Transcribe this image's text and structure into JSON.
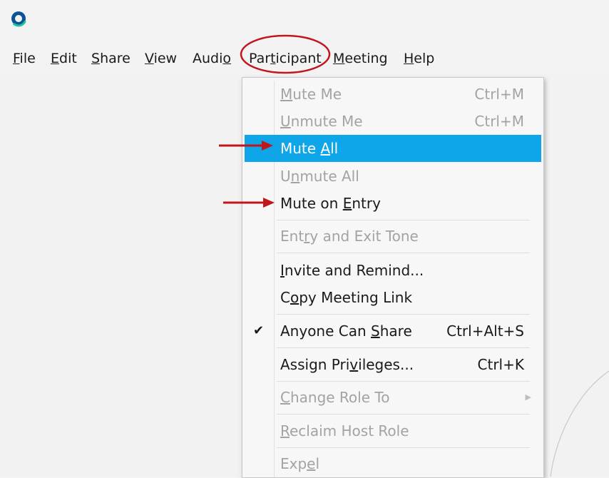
{
  "colors": {
    "selected_bg": "#0ea5e9",
    "disabled_text": "#a3a3a3",
    "annotation_red": "#c0161c"
  },
  "app": {
    "logo_icon": "webex-logo-icon"
  },
  "menubar": {
    "items": [
      {
        "pre": "",
        "u": "F",
        "post": "ile"
      },
      {
        "pre": "",
        "u": "E",
        "post": "dit"
      },
      {
        "pre": "",
        "u": "S",
        "post": "hare"
      },
      {
        "pre": "",
        "u": "V",
        "post": "iew"
      },
      {
        "pre": "Audi",
        "u": "o",
        "post": ""
      },
      {
        "pre": "Par",
        "u": "t",
        "post": "icipant"
      },
      {
        "pre": "",
        "u": "M",
        "post": "eeting"
      },
      {
        "pre": "",
        "u": "H",
        "post": "elp"
      }
    ]
  },
  "dropdown": {
    "items": [
      {
        "pre": "",
        "u": "M",
        "post": "ute Me",
        "shortcut": "Ctrl+M"
      },
      {
        "pre": "",
        "u": "U",
        "post": "nmute Me",
        "shortcut": "Ctrl+M"
      },
      {
        "pre": "Mute ",
        "u": "A",
        "post": "ll"
      },
      {
        "pre": "U",
        "u": "n",
        "post": "mute All"
      },
      {
        "pre": "Mute on ",
        "u": "E",
        "post": "ntry"
      },
      {
        "pre": "Ent",
        "u": "r",
        "post": "y and Exit Tone"
      },
      {
        "pre": "",
        "u": "I",
        "post": "nvite and Remind..."
      },
      {
        "pre": "C",
        "u": "o",
        "post": "py Meeting Link"
      },
      {
        "pre": "Anyone Can ",
        "u": "S",
        "post": "hare",
        "shortcut": "Ctrl+Alt+S",
        "check": "✔"
      },
      {
        "pre": "Assign Pri",
        "u": "v",
        "post": "ileges...",
        "shortcut": "Ctrl+K"
      },
      {
        "pre": "",
        "u": "C",
        "post": "hange Role To",
        "arrow": "▶"
      },
      {
        "pre": "",
        "u": "R",
        "post": "eclaim Host Role"
      },
      {
        "pre": "Exp",
        "u": "e",
        "post": "l"
      }
    ]
  }
}
